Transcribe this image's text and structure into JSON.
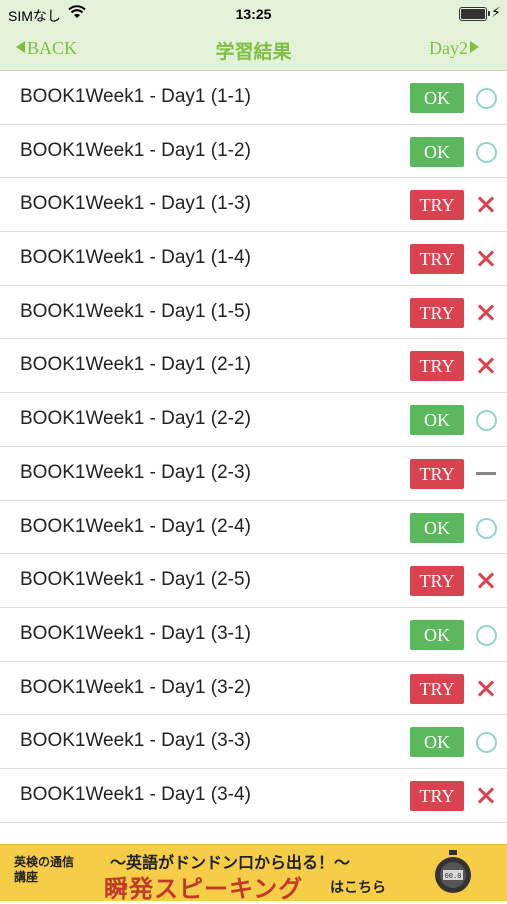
{
  "status_bar": {
    "carrier": "SIMなし",
    "time": "13:25"
  },
  "nav": {
    "back_label": "BACK",
    "title": "学習結果",
    "next_label": "Day2"
  },
  "rows": [
    {
      "label": "BOOK1Week1 - Day1  (1-1)",
      "button": "OK",
      "mark": "circle"
    },
    {
      "label": "BOOK1Week1 - Day1  (1-2)",
      "button": "OK",
      "mark": "circle"
    },
    {
      "label": "BOOK1Week1 - Day1  (1-3)",
      "button": "TRY",
      "mark": "cross"
    },
    {
      "label": "BOOK1Week1 - Day1  (1-4)",
      "button": "TRY",
      "mark": "cross"
    },
    {
      "label": "BOOK1Week1 - Day1  (1-5)",
      "button": "TRY",
      "mark": "cross"
    },
    {
      "label": "BOOK1Week1 - Day1  (2-1)",
      "button": "TRY",
      "mark": "cross"
    },
    {
      "label": "BOOK1Week1 - Day1  (2-2)",
      "button": "OK",
      "mark": "circle"
    },
    {
      "label": "BOOK1Week1 - Day1  (2-3)",
      "button": "TRY",
      "mark": "dash"
    },
    {
      "label": "BOOK1Week1 - Day1  (2-4)",
      "button": "OK",
      "mark": "circle"
    },
    {
      "label": "BOOK1Week1 - Day1  (2-5)",
      "button": "TRY",
      "mark": "cross"
    },
    {
      "label": "BOOK1Week1 - Day1  (3-1)",
      "button": "OK",
      "mark": "circle"
    },
    {
      "label": "BOOK1Week1 - Day1  (3-2)",
      "button": "TRY",
      "mark": "cross"
    },
    {
      "label": "BOOK1Week1 - Day1  (3-3)",
      "button": "OK",
      "mark": "circle"
    },
    {
      "label": "BOOK1Week1 - Day1  (3-4)",
      "button": "TRY",
      "mark": "cross"
    }
  ],
  "banner": {
    "left_text": "英検の通信講座",
    "top_text": "〜英語がドンドン口から出る！〜",
    "main_text": "瞬発スピーキング",
    "sub_text": "はこちら"
  },
  "colors": {
    "ok": "#5cb85c",
    "try": "#d9434f",
    "accent": "#7fbf3f",
    "circle": "#8fd6c9"
  }
}
